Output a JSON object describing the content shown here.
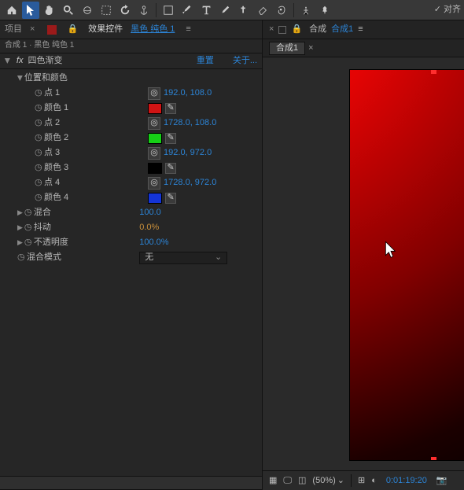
{
  "toolbar": {
    "snap_label": "对齐",
    "snap_check_glyph": "✓"
  },
  "left_panel": {
    "tabs": {
      "project": "项目",
      "fx_controls": "效果控件",
      "layer_link": "黑色 纯色 1"
    },
    "breadcrumb": "合成 1 · 黑色 纯色 1",
    "fx": {
      "name": "四色渐变",
      "reset": "重置",
      "about": "关于...",
      "pos_color_group": "位置和颜色",
      "points": [
        {
          "label": "点 1",
          "value": "192.0, 108.0"
        },
        {
          "label": "颜色 1",
          "color": "#d01414"
        },
        {
          "label": "点 2",
          "value": "1728.0, 108.0"
        },
        {
          "label": "颜色 2",
          "color": "#16d016"
        },
        {
          "label": "点 3",
          "value": "192.0, 972.0"
        },
        {
          "label": "颜色 3",
          "color": "#000000"
        },
        {
          "label": "点 4",
          "value": "1728.0, 972.0"
        },
        {
          "label": "颜色 4",
          "color": "#1434d6"
        }
      ],
      "blend": {
        "label": "混合",
        "value": "100.0"
      },
      "jitter": {
        "label": "抖动",
        "value": "0.0%"
      },
      "opacity": {
        "label": "不透明度",
        "value": "100.0%"
      },
      "mode": {
        "label": "混合模式",
        "value": "无"
      }
    }
  },
  "right_panel": {
    "title_prefix": "合成",
    "title_link": "合成1",
    "tab": "合成1",
    "zoom": "(50%)",
    "timecode": "0:01:19:20"
  }
}
